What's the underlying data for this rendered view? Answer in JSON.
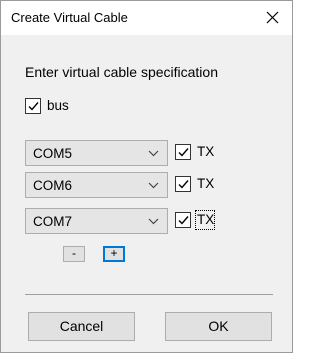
{
  "window": {
    "title": "Create Virtual Cable"
  },
  "heading": "Enter virtual cable specification",
  "bus": {
    "label": "bus",
    "checked": true
  },
  "ports": [
    {
      "value": "COM5",
      "tx_label": "TX",
      "tx_checked": true
    },
    {
      "value": "COM6",
      "tx_label": "TX",
      "tx_checked": true
    },
    {
      "value": "COM7",
      "tx_label": "TX",
      "tx_checked": true
    }
  ],
  "buttons": {
    "remove_label": "-",
    "add_label": "+",
    "cancel_label": "Cancel",
    "ok_label": "OK"
  },
  "icons": {
    "close": "close-icon",
    "check": "check-icon",
    "dropdown": "chevron-down-icon"
  },
  "colors": {
    "focus": "#0078d7"
  }
}
